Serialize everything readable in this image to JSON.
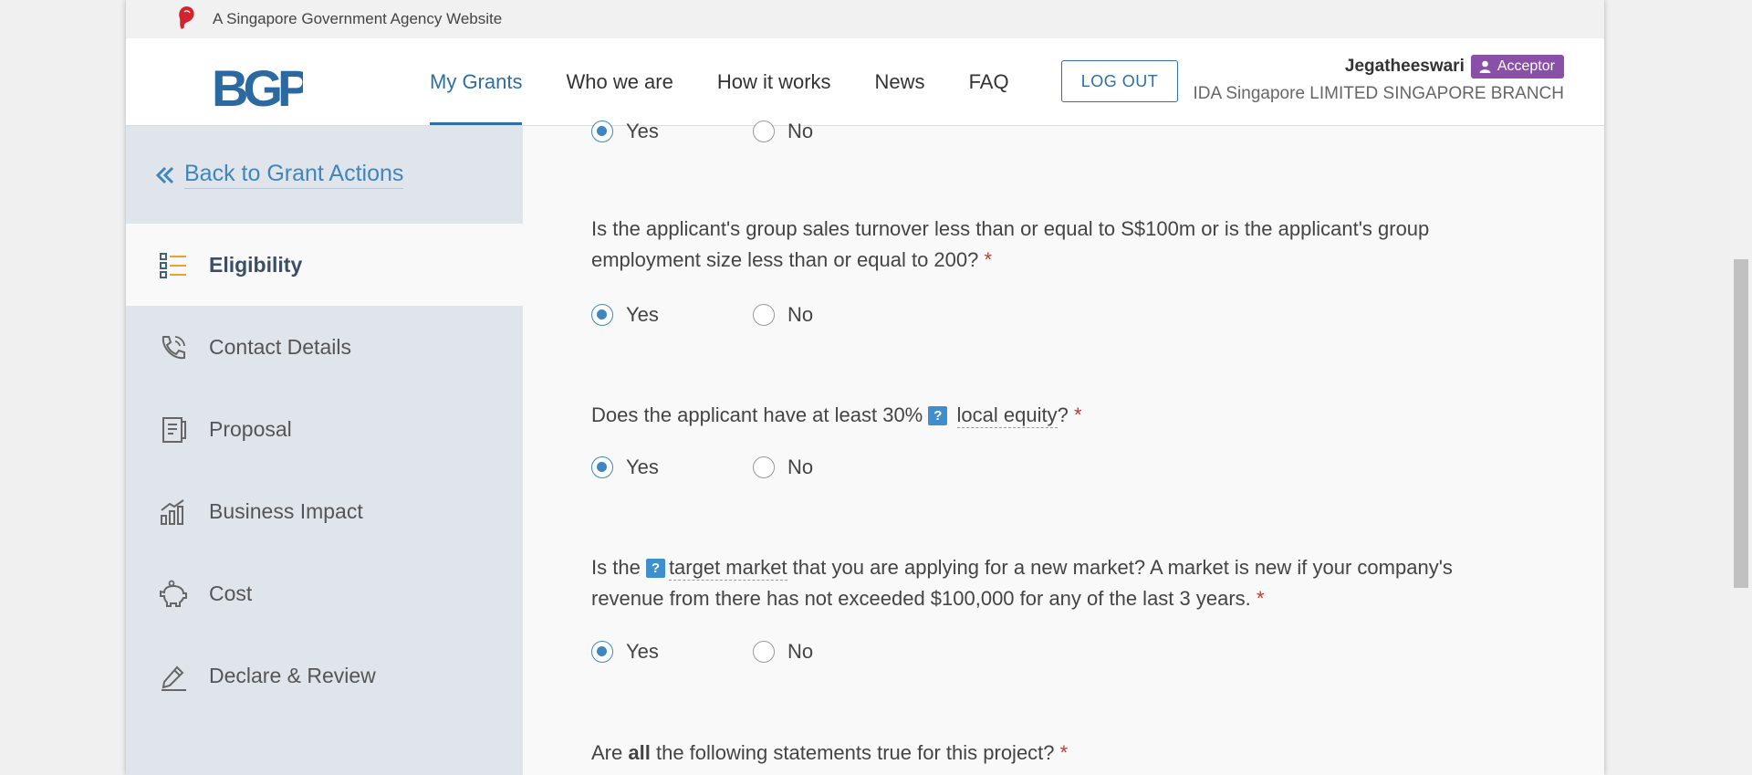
{
  "masthead": {
    "text": "A Singapore Government Agency Website"
  },
  "header": {
    "logo_text": "BGP",
    "nav": [
      {
        "label": "My Grants",
        "active": true
      },
      {
        "label": "Who we are",
        "active": false
      },
      {
        "label": "How it works",
        "active": false
      },
      {
        "label": "News",
        "active": false
      },
      {
        "label": "FAQ",
        "active": false
      }
    ],
    "logout_label": "LOG OUT",
    "user": {
      "name": "Jegatheeswari",
      "role": "Acceptor",
      "org": "IDA Singapore LIMITED SINGAPORE BRANCH"
    }
  },
  "sidebar": {
    "back_label": "Back to Grant Actions",
    "items": [
      {
        "label": "Eligibility",
        "icon": "list-icon",
        "active": true
      },
      {
        "label": "Contact Details",
        "icon": "phone-icon",
        "active": false
      },
      {
        "label": "Proposal",
        "icon": "document-icon",
        "active": false
      },
      {
        "label": "Business Impact",
        "icon": "bar-chart-icon",
        "active": false
      },
      {
        "label": "Cost",
        "icon": "piggy-bank-icon",
        "active": false
      },
      {
        "label": "Declare & Review",
        "icon": "pen-icon",
        "active": false
      }
    ]
  },
  "main": {
    "radio_labels": {
      "yes": "Yes",
      "no": "No"
    },
    "questions": [
      {
        "text": "Is the applicant's group sales turnover less than or equal to S$100m or is the applicant's group employment size less than or equal to 200?",
        "answer": "Yes"
      },
      {
        "text_before": "Does the applicant have at least 30%",
        "term": "local equity",
        "text_after": "?",
        "answer": "Yes"
      },
      {
        "text_before": "Is the",
        "term": "target market",
        "text_after": "that you are applying for a new market? A market is new if your company's revenue from there has not exceeded $100,000 for any of the last 3 years.",
        "answer": "Yes"
      },
      {
        "text_before": "Are",
        "emphasis": "all",
        "text_after": "the following statements true for this project?"
      }
    ],
    "previous_answer": "Yes",
    "required_mark": "*",
    "help_mark": "?"
  },
  "colors": {
    "brand_blue": "#2d6fa6",
    "link_blue": "#3f86c1",
    "role_purple": "#8a4fa6",
    "sidebar_bg": "#dfe5eb",
    "required_red": "#c0392b"
  }
}
